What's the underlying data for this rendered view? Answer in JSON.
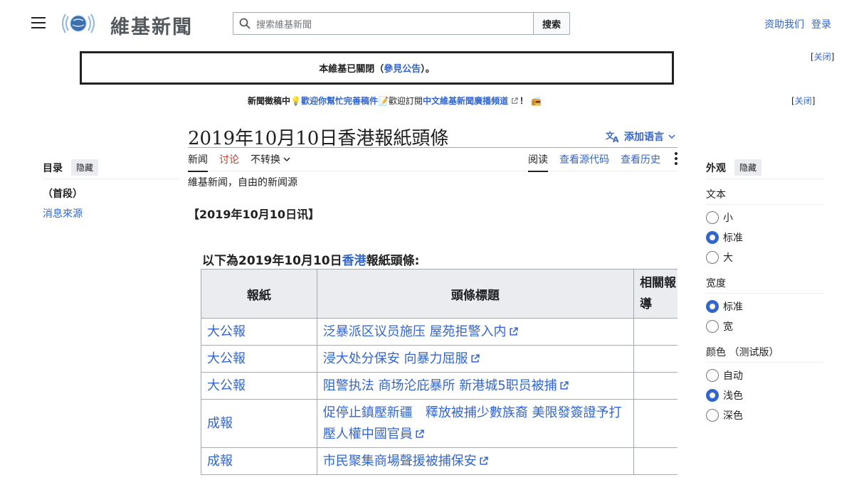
{
  "header": {
    "site_name": "維基新聞",
    "search_placeholder": "搜索維基新聞",
    "search_button": "搜索",
    "user_links": [
      "资助我们",
      "登录"
    ]
  },
  "notices": {
    "closed_prefix": "本維基已關閉（",
    "closed_link": "參見公告",
    "closed_suffix": "）。",
    "dismiss_label": "关闭",
    "news_prefix": "新聞徵稿中",
    "news_link1": "歡迎你幫忙完善稿件",
    "news_mid": "歡迎訂閱",
    "news_link2": "中文維基新聞廣播頻道",
    "news_suffix": "！"
  },
  "page": {
    "title": "2019年10月10日香港報紙頭條",
    "add_languages": "添加语言",
    "tabs_left": [
      "新闻",
      "讨论",
      "不转换"
    ],
    "tabs_right": [
      "阅读",
      "查看源代码",
      "查看历史"
    ],
    "tagline": "維基新闻，自由的新闻源",
    "dateline": "【2019年10月10日讯】",
    "caption_prefix": "以下為2019年10月10日",
    "caption_link": "香港",
    "caption_suffix": "報紙頭條:"
  },
  "table": {
    "headers": [
      "報紙",
      "頭條標題",
      "相關報導"
    ],
    "rows": [
      {
        "paper": "大公報",
        "headline": "泛暴派区议员施压 屋苑拒警入内"
      },
      {
        "paper": "大公報",
        "headline": "浸大处分保安 向暴力屈服"
      },
      {
        "paper": "大公報",
        "headline": "阻警执法 商场沦庇暴所 新港城5职员被捕"
      },
      {
        "paper": "成報",
        "headline": "促停止鎮壓新疆　釋放被捕少數族裔 美限發簽證予打壓人權中國官員"
      },
      {
        "paper": "成報",
        "headline": "市民聚集商場聲援被捕保安"
      }
    ]
  },
  "toc": {
    "title": "目录",
    "hide": "隐藏",
    "items": [
      "（首段）",
      "消息來源"
    ]
  },
  "appearance": {
    "title": "外观",
    "hide": "隐藏",
    "text_label": "文本",
    "text_options": [
      "小",
      "标准",
      "大"
    ],
    "text_selected": 1,
    "width_label": "宽度",
    "width_options": [
      "标准",
      "宽"
    ],
    "width_selected": 0,
    "color_label": "颜色 （测试版）",
    "color_options": [
      "自动",
      "浅色",
      "深色"
    ],
    "color_selected": 1
  }
}
